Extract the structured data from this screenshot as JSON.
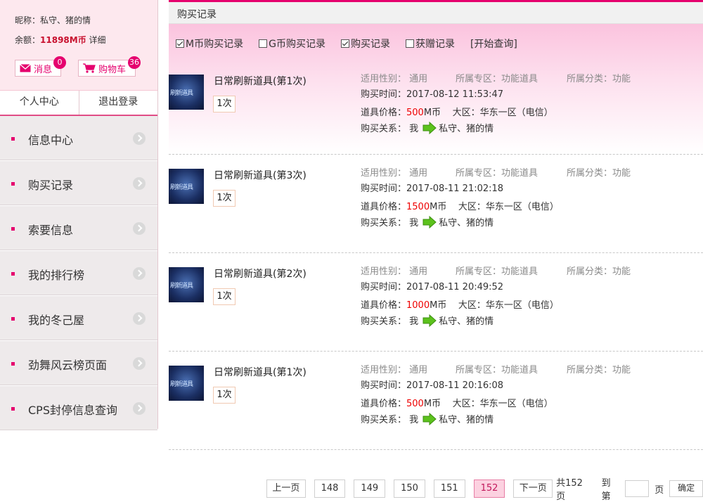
{
  "profile": {
    "nick_label": "昵称：私守、猪的情",
    "balance_prefix": "余额：",
    "balance_value": "11898M币",
    "detail_link": "详细",
    "messages_label": "消息",
    "messages_count": "0",
    "cart_label": "购物车",
    "cart_count": "36"
  },
  "account": {
    "personal_center": "个人中心",
    "logout": "退出登录"
  },
  "menu": [
    {
      "label": "信息中心"
    },
    {
      "label": "购买记录"
    },
    {
      "label": "索要信息"
    },
    {
      "label": "我的排行榜"
    },
    {
      "label": "我的冬己屋"
    },
    {
      "label": "劲舞风云榜页面"
    },
    {
      "label": "CPS封停信息查询"
    }
  ],
  "header": {
    "title": "购买记录"
  },
  "filters": [
    {
      "label": "M币购买记录",
      "checked": true
    },
    {
      "label": "G币购买记录",
      "checked": false
    },
    {
      "label": "购买记录",
      "checked": true
    },
    {
      "label": "获赠记录",
      "checked": false
    }
  ],
  "search_label": "[开始查询]",
  "items": [
    {
      "thumb_text": "刷新道具",
      "name": "日常刷新道具(第1次)",
      "count": "1次",
      "gender": "适用性别：  通用",
      "zone": "所属专区：功能道具",
      "category": "所属分类：功能",
      "time": "购买时间：2017-08-12 11:53:47",
      "price_label": "道具价格：",
      "price": "500",
      "price_unit": "M币",
      "region": "大区：华东一区（电信）",
      "relation_label": "购买关系：  我",
      "relation_target": "私守、猪的情"
    },
    {
      "thumb_text": "刷新道具",
      "name": "日常刷新道具(第3次)",
      "count": "1次",
      "gender": "适用性别：  通用",
      "zone": "所属专区：功能道具",
      "category": "所属分类：功能",
      "time": "购买时间：2017-08-11 21:02:18",
      "price_label": "道具价格：",
      "price": "1500",
      "price_unit": "M币",
      "region": "大区：华东一区（电信）",
      "relation_label": "购买关系：  我",
      "relation_target": "私守、猪的情"
    },
    {
      "thumb_text": "刷新道具",
      "name": "日常刷新道具(第2次)",
      "count": "1次",
      "gender": "适用性别：  通用",
      "zone": "所属专区：功能道具",
      "category": "所属分类：功能",
      "time": "购买时间：2017-08-11 20:49:52",
      "price_label": "道具价格：",
      "price": "1000",
      "price_unit": "M币",
      "region": "大区：华东一区（电信）",
      "relation_label": "购买关系：  我",
      "relation_target": "私守、猪的情"
    },
    {
      "thumb_text": "刷新道具",
      "name": "日常刷新道具(第1次)",
      "count": "1次",
      "gender": "适用性别：  通用",
      "zone": "所属专区：功能道具",
      "category": "所属分类：功能",
      "time": "购买时间：2017-08-11 20:16:08",
      "price_label": "道具价格：",
      "price": "500",
      "price_unit": "M币",
      "region": "大区：华东一区（电信）",
      "relation_label": "购买关系：  我",
      "relation_target": "私守、猪的情"
    }
  ],
  "pager": {
    "prev": "上一页",
    "pages": [
      "148",
      "149",
      "150",
      "151",
      "152"
    ],
    "current": "152",
    "next": "下一页",
    "total": "共152页",
    "goto_label": "到第",
    "page_unit": "页",
    "confirm": "确定"
  },
  "colors": {
    "accent": "#e5006e",
    "price": "#ee0000",
    "arrow": "#5cc21d"
  }
}
